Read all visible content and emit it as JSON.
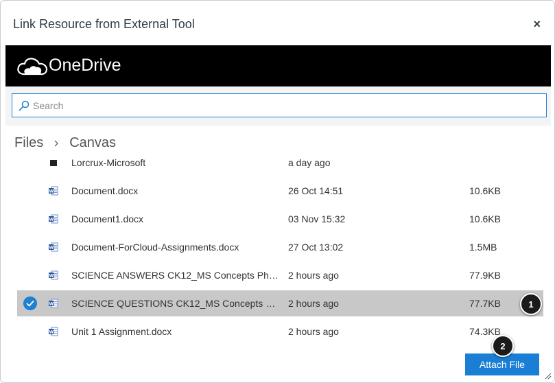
{
  "dialog": {
    "title": "Link Resource from External Tool",
    "close_label": "×"
  },
  "service": {
    "name": "OneDrive",
    "icon": "cloud-icon"
  },
  "search": {
    "placeholder": "Search",
    "value": ""
  },
  "breadcrumb": {
    "items": [
      "Files",
      "Canvas"
    ]
  },
  "files": [
    {
      "name": "Lorcrux-Microsoft",
      "date": "a day ago",
      "size": "",
      "icon": "folder-icon",
      "selected": false
    },
    {
      "name": "Document.docx",
      "date": "26 Oct 14:51",
      "size": "10.6KB",
      "icon": "word-doc-icon",
      "selected": false
    },
    {
      "name": "Document1.docx",
      "date": "03 Nov 15:32",
      "size": "10.6KB",
      "icon": "word-doc-icon",
      "selected": false
    },
    {
      "name": "Document-ForCloud-Assignments.docx",
      "date": "27 Oct 13:02",
      "size": "1.5MB",
      "icon": "word-doc-icon",
      "selected": false
    },
    {
      "name": "SCIENCE ANSWERS CK12_MS Concepts Physic...",
      "date": "2 hours ago",
      "size": "77.9KB",
      "icon": "word-doc-icon",
      "selected": false
    },
    {
      "name": "SCIENCE QUESTIONS CK12_MS Concepts Phy...",
      "date": "2 hours ago",
      "size": "77.7KB",
      "icon": "word-doc-icon",
      "selected": true
    },
    {
      "name": "Unit 1 Assignment.docx",
      "date": "2 hours ago",
      "size": "74.3KB",
      "icon": "word-doc-icon",
      "selected": false
    }
  ],
  "markers": [
    "1",
    "2"
  ],
  "actions": {
    "attach_label": "Attach File"
  },
  "colors": {
    "accent": "#1a7fd4",
    "header_bg": "#000000",
    "selected_row": "#c8c8c8",
    "search_border": "#1f7fd0"
  }
}
